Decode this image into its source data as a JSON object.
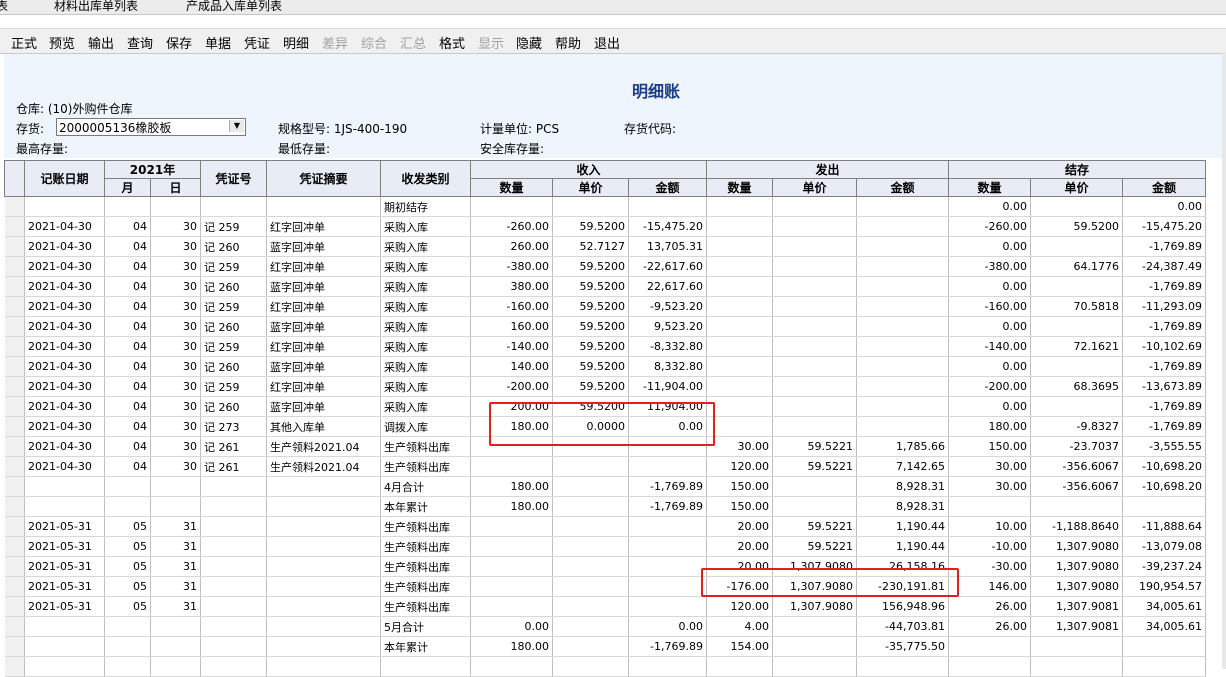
{
  "tabs": {
    "partial": "表",
    "t1": "材料出库单列表",
    "t2": "产成品入库单列表"
  },
  "toolbar": [
    {
      "label": "正式",
      "enabled": true
    },
    {
      "label": "预览",
      "enabled": true
    },
    {
      "label": "输出",
      "enabled": true
    },
    {
      "label": "查询",
      "enabled": true
    },
    {
      "label": "保存",
      "enabled": true
    },
    {
      "label": "单据",
      "enabled": true
    },
    {
      "label": "凭证",
      "enabled": true
    },
    {
      "label": "明细",
      "enabled": true
    },
    {
      "label": "差异",
      "enabled": false
    },
    {
      "label": "综合",
      "enabled": false
    },
    {
      "label": "汇总",
      "enabled": false
    },
    {
      "label": "格式",
      "enabled": true
    },
    {
      "label": "显示",
      "enabled": false
    },
    {
      "label": "隐藏",
      "enabled": true
    },
    {
      "label": "帮助",
      "enabled": true
    },
    {
      "label": "退出",
      "enabled": true
    }
  ],
  "report": {
    "title": "明细账",
    "warehouse": "仓库: (10)外购件仓库",
    "inventory_label": "存货:",
    "inventory_value": "2000005136橡胶板",
    "spec": "规格型号: 1JS-400-190",
    "unit": "计量单位: PCS",
    "inv_code": "存货代码:",
    "max_stock": "最高存量:",
    "min_stock": "最低存量:",
    "safe_stock": "安全库存量:"
  },
  "columns": {
    "date": "记账日期",
    "year": "2021年",
    "month": "月",
    "day": "日",
    "voucher": "凭证号",
    "summary": "凭证摘要",
    "type": "收发类别",
    "in": "收入",
    "out": "发出",
    "balance": "结存",
    "qty": "数量",
    "price": "单价",
    "amount": "金额"
  },
  "rows": [
    [
      "",
      "",
      "",
      "",
      "",
      "期初结存",
      "",
      "",
      "",
      "",
      "",
      "",
      "0.00",
      "",
      "0.00"
    ],
    [
      "2021-04-30",
      "04",
      "30",
      "记 259",
      "红字回冲单",
      "采购入库",
      "-260.00",
      "59.5200",
      "-15,475.20",
      "",
      "",
      "",
      "-260.00",
      "59.5200",
      "-15,475.20"
    ],
    [
      "2021-04-30",
      "04",
      "30",
      "记 260",
      "蓝字回冲单",
      "采购入库",
      "260.00",
      "52.7127",
      "13,705.31",
      "",
      "",
      "",
      "0.00",
      "",
      "-1,769.89"
    ],
    [
      "2021-04-30",
      "04",
      "30",
      "记 259",
      "红字回冲单",
      "采购入库",
      "-380.00",
      "59.5200",
      "-22,617.60",
      "",
      "",
      "",
      "-380.00",
      "64.1776",
      "-24,387.49"
    ],
    [
      "2021-04-30",
      "04",
      "30",
      "记 260",
      "蓝字回冲单",
      "采购入库",
      "380.00",
      "59.5200",
      "22,617.60",
      "",
      "",
      "",
      "0.00",
      "",
      "-1,769.89"
    ],
    [
      "2021-04-30",
      "04",
      "30",
      "记 259",
      "红字回冲单",
      "采购入库",
      "-160.00",
      "59.5200",
      "-9,523.20",
      "",
      "",
      "",
      "-160.00",
      "70.5818",
      "-11,293.09"
    ],
    [
      "2021-04-30",
      "04",
      "30",
      "记 260",
      "蓝字回冲单",
      "采购入库",
      "160.00",
      "59.5200",
      "9,523.20",
      "",
      "",
      "",
      "0.00",
      "",
      "-1,769.89"
    ],
    [
      "2021-04-30",
      "04",
      "30",
      "记 259",
      "红字回冲单",
      "采购入库",
      "-140.00",
      "59.5200",
      "-8,332.80",
      "",
      "",
      "",
      "-140.00",
      "72.1621",
      "-10,102.69"
    ],
    [
      "2021-04-30",
      "04",
      "30",
      "记 260",
      "蓝字回冲单",
      "采购入库",
      "140.00",
      "59.5200",
      "8,332.80",
      "",
      "",
      "",
      "0.00",
      "",
      "-1,769.89"
    ],
    [
      "2021-04-30",
      "04",
      "30",
      "记 259",
      "红字回冲单",
      "采购入库",
      "-200.00",
      "59.5200",
      "-11,904.00",
      "",
      "",
      "",
      "-200.00",
      "68.3695",
      "-13,673.89"
    ],
    [
      "2021-04-30",
      "04",
      "30",
      "记 260",
      "蓝字回冲单",
      "采购入库",
      "200.00",
      "59.5200",
      "11,904.00",
      "",
      "",
      "",
      "0.00",
      "",
      "-1,769.89"
    ],
    [
      "2021-04-30",
      "04",
      "30",
      "记 273",
      "其他入库单",
      "调拨入库",
      "180.00",
      "0.0000",
      "0.00",
      "",
      "",
      "",
      "180.00",
      "-9.8327",
      "-1,769.89"
    ],
    [
      "2021-04-30",
      "04",
      "30",
      "记 261",
      "生产领料2021.04",
      "生产领料出库",
      "",
      "",
      "",
      "30.00",
      "59.5221",
      "1,785.66",
      "150.00",
      "-23.7037",
      "-3,555.55"
    ],
    [
      "2021-04-30",
      "04",
      "30",
      "记 261",
      "生产领料2021.04",
      "生产领料出库",
      "",
      "",
      "",
      "120.00",
      "59.5221",
      "7,142.65",
      "30.00",
      "-356.6067",
      "-10,698.20"
    ],
    [
      "",
      "",
      "",
      "",
      "",
      "4月合计",
      "180.00",
      "",
      "-1,769.89",
      "150.00",
      "",
      "8,928.31",
      "30.00",
      "-356.6067",
      "-10,698.20"
    ],
    [
      "",
      "",
      "",
      "",
      "",
      "本年累计",
      "180.00",
      "",
      "-1,769.89",
      "150.00",
      "",
      "8,928.31",
      "",
      "",
      ""
    ],
    [
      "2021-05-31",
      "05",
      "31",
      "",
      "",
      "生产领料出库",
      "",
      "",
      "",
      "20.00",
      "59.5221",
      "1,190.44",
      "10.00",
      "-1,188.8640",
      "-11,888.64"
    ],
    [
      "2021-05-31",
      "05",
      "31",
      "",
      "",
      "生产领料出库",
      "",
      "",
      "",
      "20.00",
      "59.5221",
      "1,190.44",
      "-10.00",
      "1,307.9080",
      "-13,079.08"
    ],
    [
      "2021-05-31",
      "05",
      "31",
      "",
      "",
      "生产领料出库",
      "",
      "",
      "",
      "20.00",
      "1,307.9080",
      "26,158.16",
      "-30.00",
      "1,307.9080",
      "-39,237.24"
    ],
    [
      "2021-05-31",
      "05",
      "31",
      "",
      "",
      "生产领料出库",
      "",
      "",
      "",
      "-176.00",
      "1,307.9080",
      "-230,191.81",
      "146.00",
      "1,307.9080",
      "190,954.57"
    ],
    [
      "2021-05-31",
      "05",
      "31",
      "",
      "",
      "生产领料出库",
      "",
      "",
      "",
      "120.00",
      "1,307.9080",
      "156,948.96",
      "26.00",
      "1,307.9081",
      "34,005.61"
    ],
    [
      "",
      "",
      "",
      "",
      "",
      "5月合计",
      "0.00",
      "",
      "0.00",
      "4.00",
      "",
      "-44,703.81",
      "26.00",
      "1,307.9081",
      "34,005.61"
    ],
    [
      "",
      "",
      "",
      "",
      "",
      "本年累计",
      "180.00",
      "",
      "-1,769.89",
      "154.00",
      "",
      "-35,775.50",
      "",
      "",
      ""
    ]
  ]
}
